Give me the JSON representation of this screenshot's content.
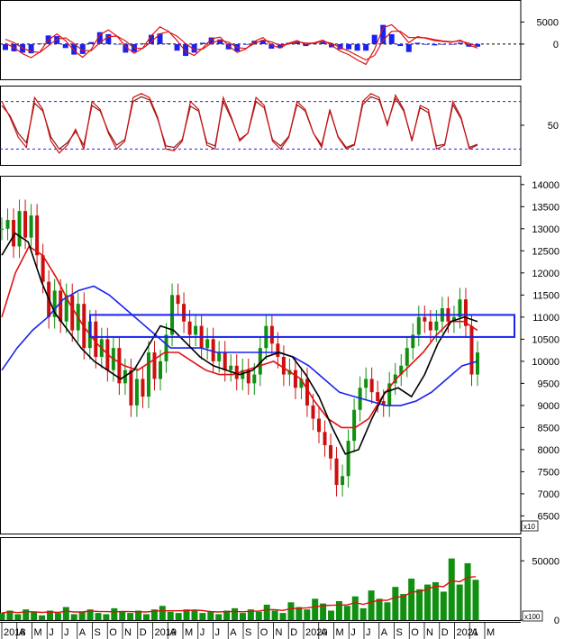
{
  "chart_data": [
    {
      "type": "area",
      "panel": "oscillator",
      "yticks": [
        5000,
        0
      ],
      "ylim": [
        -8000,
        10000
      ],
      "reference_lines": [
        0
      ],
      "colors": {
        "line1": "#e01010",
        "line2": "#d81818",
        "histogram": "#1a22ee"
      },
      "series": [
        {
          "values": [
            200,
            -800,
            -2200,
            -3100,
            -1800,
            900,
            2300,
            800,
            -1500,
            -3000,
            -1200,
            2100,
            3200,
            1800,
            -600,
            -2100,
            -900,
            1900,
            3900,
            2900,
            800,
            -1700,
            -2600,
            -900,
            1200,
            1600,
            -400,
            -1900,
            -1100,
            600,
            1500,
            -200,
            -900,
            200,
            800,
            -100,
            300,
            900,
            -300,
            -1600,
            -2400,
            -3600,
            -4600,
            -1200,
            3700,
            4400,
            2600,
            300,
            1700,
            1300,
            800,
            600,
            400,
            900,
            -200,
            -900
          ]
        },
        {
          "values": [
            1100,
            300,
            -900,
            -1700,
            -1900,
            -400,
            1100,
            1400,
            100,
            -1500,
            -1500,
            300,
            1700,
            1800,
            700,
            -900,
            -1000,
            500,
            2300,
            2800,
            1800,
            100,
            -1300,
            -1100,
            200,
            900,
            400,
            -800,
            -1000,
            100,
            900,
            500,
            -300,
            0,
            500,
            200,
            200,
            600,
            200,
            -800,
            -1600,
            -2600,
            -3600,
            -2600,
            800,
            2900,
            2900,
            1500,
            1500,
            1400,
            1000,
            700,
            500,
            700,
            200,
            -500
          ]
        }
      ]
    },
    {
      "type": "line",
      "panel": "stochastic",
      "yticks": [
        50
      ],
      "ylim": [
        0,
        100
      ],
      "reference_lines": [
        80,
        20
      ],
      "colors": {
        "k": "#cc1111",
        "d": "#8b1a1a",
        "reference": "#1a22ee"
      },
      "series": [
        {
          "values": [
            80,
            60,
            35,
            22,
            85,
            70,
            30,
            15,
            25,
            45,
            20,
            80,
            70,
            40,
            20,
            30,
            85,
            90,
            85,
            60,
            20,
            18,
            30,
            80,
            70,
            25,
            20,
            85,
            60,
            30,
            40,
            85,
            75,
            30,
            20,
            35,
            80,
            70,
            40,
            22,
            70,
            35,
            20,
            25,
            80,
            90,
            85,
            50,
            88,
            70,
            30,
            75,
            70,
            20,
            25,
            80,
            60,
            20,
            25
          ]
        },
        {
          "values": [
            75,
            62,
            40,
            28,
            78,
            68,
            35,
            20,
            28,
            42,
            25,
            75,
            68,
            42,
            25,
            32,
            80,
            86,
            82,
            58,
            24,
            22,
            32,
            74,
            68,
            28,
            24,
            80,
            58,
            32,
            40,
            80,
            72,
            32,
            24,
            36,
            76,
            68,
            40,
            25,
            68,
            36,
            22,
            26,
            76,
            86,
            82,
            52,
            84,
            68,
            32,
            72,
            66,
            24,
            26,
            76,
            58,
            22,
            26
          ]
        }
      ]
    },
    {
      "type": "line",
      "panel": "price",
      "title": "",
      "yticks": [
        14000,
        13500,
        13000,
        12500,
        12000,
        11500,
        11000,
        10500,
        10000,
        9500,
        9000,
        8500,
        8000,
        7500,
        7000,
        6500
      ],
      "ylim": [
        6100,
        14200
      ],
      "unit_label": "x10",
      "x_labels": [
        "2018",
        "A",
        "M",
        "J",
        "J",
        "A",
        "S",
        "O",
        "N",
        "D",
        "2019",
        "A",
        "M",
        "J",
        "J",
        "A",
        "S",
        "O",
        "N",
        "D",
        "2020",
        "A",
        "M",
        "J",
        "J",
        "A",
        "S",
        "O",
        "N",
        "D",
        "2021",
        "A",
        "M"
      ],
      "colors": {
        "up": "#109010",
        "down": "#cc1010",
        "ma_short": "#000000",
        "ma_mid": "#e01010",
        "ma_long": "#1a22ee",
        "zone": "#1a22ee"
      },
      "resistance_zone": [
        10550,
        11050
      ],
      "price": {
        "values": [
          13000,
          13200,
          12600,
          13400,
          12800,
          13300,
          12400,
          11800,
          11000,
          11600,
          10900,
          11500,
          10700,
          11300,
          10300,
          10900,
          10100,
          10500,
          9800,
          10300,
          9500,
          9800,
          9000,
          9600,
          9200,
          10200,
          9600,
          10000,
          10600,
          11500,
          11300,
          10900,
          10600,
          10800,
          10300,
          10500,
          10000,
          10200,
          9800,
          9900,
          9600,
          9800,
          9500,
          9700,
          10300,
          10800,
          10400,
          10100,
          9700,
          9800,
          9400,
          9600,
          9000,
          8700,
          8400,
          8100,
          7800,
          7200,
          7400,
          8200,
          8900,
          9400,
          9600,
          9300,
          9100,
          9000,
          9500,
          9700,
          9900,
          10300,
          10600,
          11000,
          10900,
          10700,
          10900,
          11200,
          10900,
          11000,
          11400,
          10800,
          9700,
          10200
        ]
      },
      "series": [
        {
          "values": [
            12400,
            12900,
            12700,
            11800,
            11100,
            10700,
            10300,
            10000,
            9800,
            9600,
            9800,
            10300,
            10800,
            10700,
            10400,
            10100,
            9900,
            9800,
            9700,
            9800,
            10100,
            10200,
            10100,
            9700,
            9200,
            8500,
            7900,
            8000,
            8700,
            9300,
            9400,
            9200,
            9700,
            10400,
            10900,
            11000,
            10900
          ]
        },
        {
          "values": [
            11000,
            12000,
            12600,
            12400,
            11900,
            11300,
            10800,
            10400,
            10100,
            9900,
            9800,
            10000,
            10200,
            10200,
            10000,
            9800,
            9700,
            9700,
            9800,
            9900,
            10000,
            9800,
            9600,
            9100,
            8700,
            8500,
            8500,
            8700,
            9200,
            9600,
            9900,
            10200,
            10600,
            10900,
            10900,
            10700
          ]
        },
        {
          "values": [
            9800,
            10300,
            10700,
            11000,
            11400,
            11600,
            11700,
            11500,
            11200,
            10900,
            10600,
            10300,
            10300,
            10300,
            10200,
            10200,
            10200,
            10200,
            10200,
            10100,
            9900,
            9600,
            9300,
            9200,
            9100,
            9000,
            9000,
            9100,
            9300,
            9600,
            9900,
            10000
          ]
        }
      ]
    },
    {
      "type": "bar",
      "panel": "volume",
      "yticks": [
        50000,
        0
      ],
      "ylim": [
        0,
        70000
      ],
      "unit_label": "x100",
      "colors": {
        "bars": "#109010",
        "ma": "#e01010"
      },
      "values": [
        6000,
        8000,
        5000,
        9000,
        7000,
        4000,
        8000,
        6000,
        11000,
        5000,
        7000,
        9000,
        6000,
        5000,
        10000,
        7000,
        6000,
        8000,
        5000,
        9000,
        12000,
        7000,
        6000,
        9000,
        8000,
        6000,
        7000,
        5000,
        8000,
        10000,
        6000,
        9000,
        7000,
        13000,
        8000,
        6000,
        15000,
        11000,
        9000,
        18000,
        14000,
        8000,
        16000,
        12000,
        20000,
        10000,
        25000,
        18000,
        15000,
        28000,
        22000,
        35000,
        26000,
        30000,
        32000,
        24000,
        52000,
        30000,
        48000,
        34000
      ]
    }
  ]
}
